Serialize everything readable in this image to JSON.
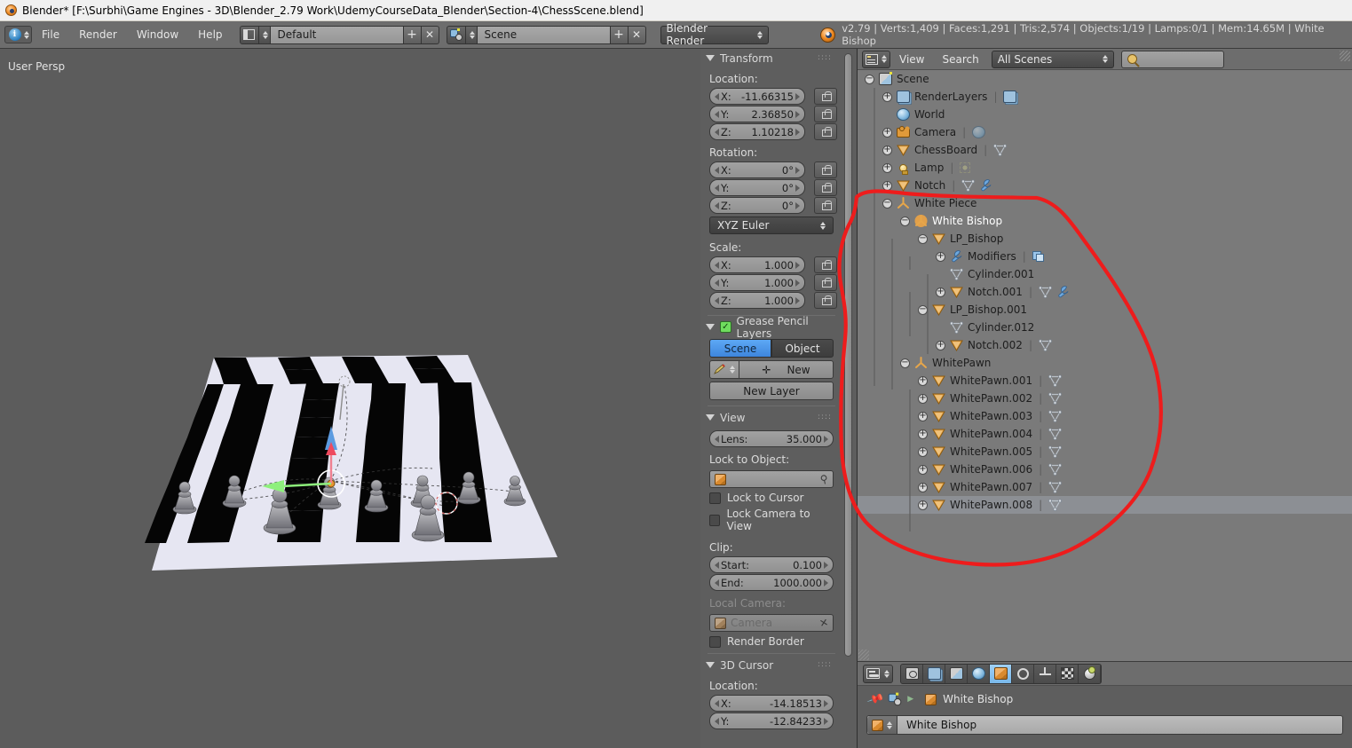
{
  "window": {
    "title": "Blender* [F:\\Surbhi\\Game Engines - 3D\\Blender_2.79 Work\\UdemyCourseData_Blender\\Section-4\\ChessScene.blend]"
  },
  "topbar": {
    "menus": [
      "File",
      "Render",
      "Window",
      "Help"
    ],
    "screen_layout": "Default",
    "scene_name": "Scene",
    "render_engine": "Blender Render",
    "stats": "v2.79 | Verts:1,409 | Faces:1,291 | Tris:2,574 | Objects:1/19 | Lamps:0/1 | Mem:14.65M | White Bishop"
  },
  "viewport": {
    "view_label": "User Persp"
  },
  "properties_panel": {
    "transform": {
      "title": "Transform",
      "location_label": "Location:",
      "location": [
        {
          "axis": "X:",
          "value": "-11.66315"
        },
        {
          "axis": "Y:",
          "value": "2.36850"
        },
        {
          "axis": "Z:",
          "value": "1.10218"
        }
      ],
      "rotation_label": "Rotation:",
      "rotation": [
        {
          "axis": "X:",
          "value": "0°"
        },
        {
          "axis": "Y:",
          "value": "0°"
        },
        {
          "axis": "Z:",
          "value": "0°"
        }
      ],
      "rotation_mode": "XYZ Euler",
      "scale_label": "Scale:",
      "scale": [
        {
          "axis": "X:",
          "value": "1.000"
        },
        {
          "axis": "Y:",
          "value": "1.000"
        },
        {
          "axis": "Z:",
          "value": "1.000"
        }
      ]
    },
    "grease_pencil": {
      "title": "Grease Pencil Layers",
      "tab_scene": "Scene",
      "tab_object": "Object",
      "new_button": "New",
      "new_layer_button": "New Layer"
    },
    "view": {
      "title": "View",
      "lens_label": "Lens:",
      "lens_value": "35.000",
      "lock_to_object_label": "Lock to Object:",
      "lock_to_object_value": "",
      "lock_to_cursor": "Lock to Cursor",
      "lock_camera_to_view": "Lock Camera to View",
      "clip_label": "Clip:",
      "clip_start_label": "Start:",
      "clip_start_value": "0.100",
      "clip_end_label": "End:",
      "clip_end_value": "1000.000",
      "local_camera_label": "Local Camera:",
      "local_camera_value": "Camera",
      "render_border": "Render Border"
    },
    "cursor3d": {
      "title": "3D Cursor",
      "location_label": "Location:",
      "location": [
        {
          "axis": "X:",
          "value": "-14.18513"
        },
        {
          "axis": "Y:",
          "value": "-12.84233"
        }
      ]
    }
  },
  "outliner": {
    "header": {
      "view_menu": "View",
      "search_menu": "Search",
      "display_mode": "All Scenes",
      "search_placeholder": ""
    },
    "rows": [
      {
        "label": "Scene",
        "indent": 0,
        "expander": "minus",
        "icon": "scene-icon",
        "extras": []
      },
      {
        "label": "RenderLayers",
        "indent": 1,
        "expander": "plus",
        "icon": "renderlayers-icon",
        "extras": [
          "renderlayers-icon"
        ]
      },
      {
        "label": "World",
        "indent": 1,
        "expander": "none",
        "icon": "world-icon",
        "extras": []
      },
      {
        "label": "Camera",
        "indent": 1,
        "expander": "plus",
        "icon": "camera-icon",
        "extras": [
          "camera-data-icon"
        ]
      },
      {
        "label": "ChessBoard",
        "indent": 1,
        "expander": "plus",
        "icon": "mesh-object-icon",
        "extras": [
          "mesh-data-icon"
        ]
      },
      {
        "label": "Lamp",
        "indent": 1,
        "expander": "plus",
        "icon": "lamp-icon",
        "extras": [
          "lamp-data-icon"
        ]
      },
      {
        "label": "Notch",
        "indent": 1,
        "expander": "plus",
        "icon": "mesh-object-icon",
        "extras": [
          "mesh-data-icon",
          "wrench-icon"
        ]
      },
      {
        "label": "White Piece",
        "indent": 1,
        "expander": "minus",
        "icon": "empty-axis-icon",
        "extras": []
      },
      {
        "label": "White Bishop",
        "indent": 2,
        "expander": "minus",
        "icon": "empty-axis-highlight-icon",
        "extras": [],
        "active": true
      },
      {
        "label": "LP_Bishop",
        "indent": 3,
        "expander": "minus",
        "icon": "mesh-object-icon",
        "extras": []
      },
      {
        "label": "Modifiers",
        "indent": 4,
        "expander": "plus",
        "icon": "wrench-icon",
        "extras": [
          "modifier-icon"
        ]
      },
      {
        "label": "Cylinder.001",
        "indent": 4,
        "expander": "none",
        "icon": "mesh-data-icon",
        "extras": []
      },
      {
        "label": "Notch.001",
        "indent": 4,
        "expander": "plus",
        "icon": "mesh-object-icon",
        "extras": [
          "mesh-data-icon",
          "wrench-icon"
        ]
      },
      {
        "label": "LP_Bishop.001",
        "indent": 3,
        "expander": "minus",
        "icon": "mesh-object-icon",
        "extras": []
      },
      {
        "label": "Cylinder.012",
        "indent": 4,
        "expander": "none",
        "icon": "mesh-data-icon",
        "extras": []
      },
      {
        "label": "Notch.002",
        "indent": 4,
        "expander": "plus",
        "icon": "mesh-object-icon",
        "extras": [
          "mesh-data-icon"
        ]
      },
      {
        "label": "WhitePawn",
        "indent": 2,
        "expander": "minus",
        "icon": "empty-axis-icon",
        "extras": []
      },
      {
        "label": "WhitePawn.001",
        "indent": 3,
        "expander": "plus",
        "icon": "mesh-object-icon",
        "extras": [
          "mesh-data-icon"
        ]
      },
      {
        "label": "WhitePawn.002",
        "indent": 3,
        "expander": "plus",
        "icon": "mesh-object-icon",
        "extras": [
          "mesh-data-icon"
        ]
      },
      {
        "label": "WhitePawn.003",
        "indent": 3,
        "expander": "plus",
        "icon": "mesh-object-icon",
        "extras": [
          "mesh-data-icon"
        ]
      },
      {
        "label": "WhitePawn.004",
        "indent": 3,
        "expander": "plus",
        "icon": "mesh-object-icon",
        "extras": [
          "mesh-data-icon"
        ]
      },
      {
        "label": "WhitePawn.005",
        "indent": 3,
        "expander": "plus",
        "icon": "mesh-object-icon",
        "extras": [
          "mesh-data-icon"
        ]
      },
      {
        "label": "WhitePawn.006",
        "indent": 3,
        "expander": "plus",
        "icon": "mesh-object-icon",
        "extras": [
          "mesh-data-icon"
        ]
      },
      {
        "label": "WhitePawn.007",
        "indent": 3,
        "expander": "plus",
        "icon": "mesh-object-icon",
        "extras": [
          "mesh-data-icon"
        ]
      },
      {
        "label": "WhitePawn.008",
        "indent": 3,
        "expander": "plus",
        "icon": "mesh-object-icon",
        "extras": [
          "mesh-data-icon"
        ],
        "selected": true
      }
    ]
  },
  "properties_editor": {
    "tabs": [
      "render-tab",
      "render-layers-tab",
      "scene-tab",
      "world-tab",
      "object-tab",
      "constraints-tab",
      "object-data-tab",
      "texture-tab",
      "material-tab"
    ],
    "active_tab": "object-tab",
    "breadcrumb": "White Bishop",
    "object_name": "White Bishop"
  },
  "annotation": {
    "color": "#ee1c1c",
    "shape": "freehand-circle-around-white-piece-hierarchy"
  }
}
